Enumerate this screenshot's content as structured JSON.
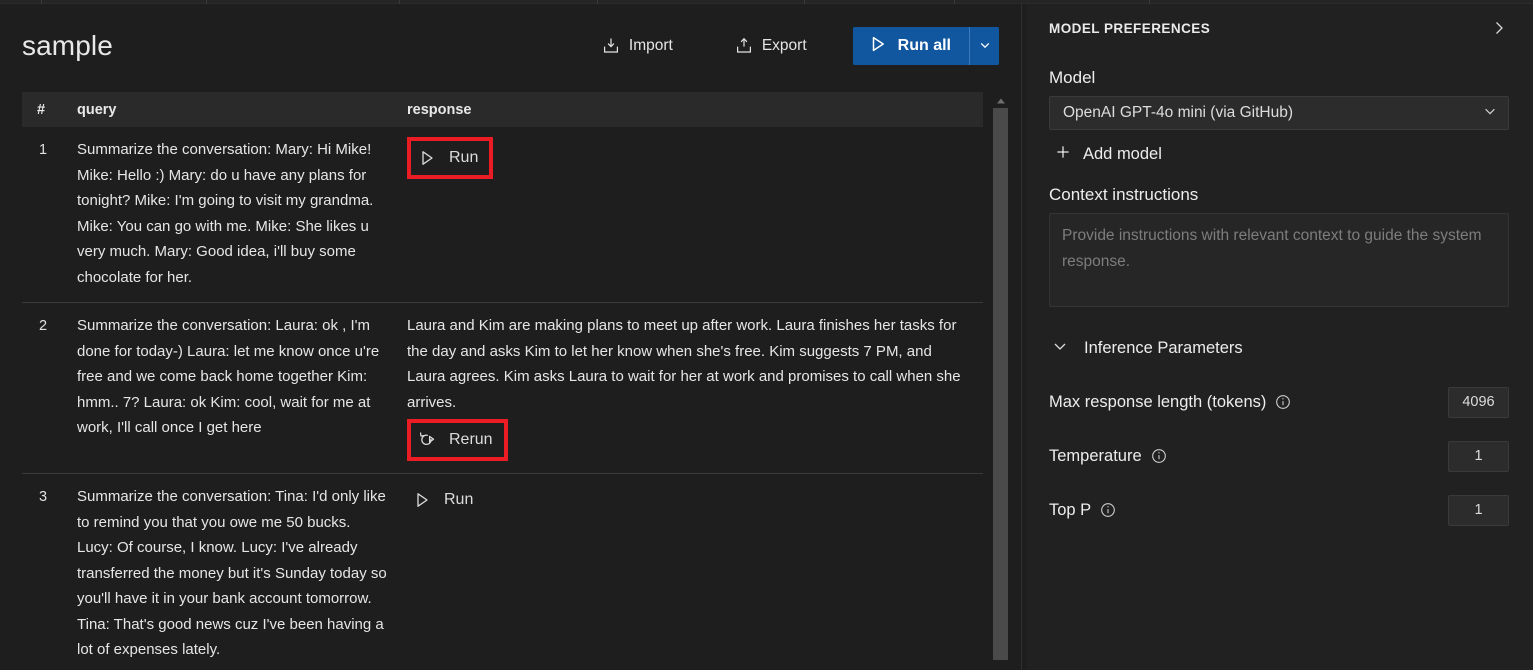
{
  "toolbar": {
    "doc_title": "sample",
    "import_label": "Import",
    "import_icon": "import-download-icon",
    "export_label": "Export",
    "export_icon": "export-upload-icon",
    "run_all_label": "Run all",
    "run_all_icon": "play-outline-icon",
    "run_all_caret_icon": "chevron-down-icon",
    "accent_color": "#11579f"
  },
  "grid": {
    "columns": [
      "#",
      "query",
      "response"
    ],
    "rows": [
      {
        "index": "1",
        "query": "Summarize the conversation: Mary: Hi Mike! Mike: Hello :) Mary: do u have any plans for tonight? Mike: I'm going to visit my grandma. Mike: You can go with me. Mike: She likes u very much. Mary: Good idea, i'll buy some chocolate for her.",
        "response": "",
        "action_label": "Run",
        "action_icon": "play-outline-icon",
        "highlighted": true
      },
      {
        "index": "2",
        "query": "Summarize the conversation: Laura: ok , I'm done for today-) Laura: let me know once u're free and we come back home together Kim: hmm.. 7? Laura: ok Kim: cool, wait for me at work, I'll call once I get here",
        "response": "Laura and Kim are making plans to meet up after work. Laura finishes her tasks for the day and asks Kim to let her know when she's free. Kim suggests 7 PM, and Laura agrees. Kim asks Laura to wait for her at work and promises to call when she arrives.",
        "action_label": "Rerun",
        "action_icon": "rerun-circular-arrow-play-icon",
        "highlighted": true
      },
      {
        "index": "3",
        "query": "Summarize the conversation: Tina: I'd only like to remind you that you owe me 50 bucks. Lucy: Of course, I know. Lucy: I've already transferred the money but it's Sunday today so you'll have it in your bank account tomorrow. Tina: That's good news cuz I've been having a lot of expenses lately.",
        "response": "",
        "action_label": "Run",
        "action_icon": "play-outline-icon",
        "highlighted": false
      }
    ],
    "scrollbar": {
      "up_arrow_icon": "scroll-up-arrow-icon"
    },
    "highlight_color": "#ec1c24"
  },
  "model_preferences": {
    "header": "MODEL PREFERENCES",
    "collapse_icon": "chevron-right-icon",
    "model_label": "Model",
    "model_value": "OpenAI GPT-4o mini (via GitHub)",
    "model_dropdown_icon": "chevron-down-icon",
    "add_model_label": "Add model",
    "add_model_icon": "plus-icon",
    "context_label": "Context instructions",
    "context_placeholder": "Provide instructions with relevant context to guide the system response.",
    "context_value": "",
    "inference_section_label": "Inference Parameters",
    "inference_section_icon": "chevron-down-icon",
    "parameters": [
      {
        "label": "Max response length (tokens)",
        "value": "4096",
        "info_icon": "info-circle-icon"
      },
      {
        "label": "Temperature",
        "value": "1",
        "info_icon": "info-circle-icon"
      },
      {
        "label": "Top P",
        "value": "1",
        "info_icon": "info-circle-icon"
      }
    ]
  }
}
